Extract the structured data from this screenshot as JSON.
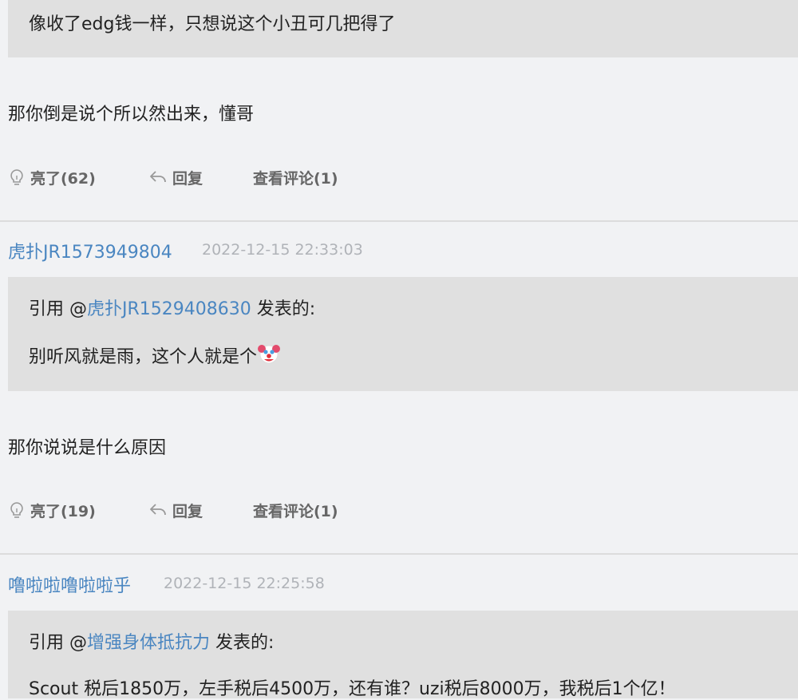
{
  "post0": {
    "quote_text": "像收了edg钱一样，只想说这个小丑可几把得了",
    "reply": "那你倒是说个所以然出来，懂哥",
    "like_label": "亮了(62)",
    "reply_label": "回复",
    "comments_label": "查看评论(1)"
  },
  "post1": {
    "username": "虎扑JR1573949804",
    "time": "2022-12-15 22:33:03",
    "quote_prefix": "引用 @",
    "quote_user": "虎扑JR1529408630",
    "quote_suffix": " 发表的:",
    "quote_text": "别听风就是雨，这个人就是个",
    "quote_emoji": "clown-face-icon",
    "reply": "那你说说是什么原因",
    "like_label": "亮了(19)",
    "reply_label": "回复",
    "comments_label": "查看评论(1)"
  },
  "post2": {
    "username": "噜啦啦噜啦啦乎",
    "time": "2022-12-15 22:25:58",
    "quote_prefix": "引用 @",
    "quote_user": "增强身体抵抗力",
    "quote_suffix": " 发表的:",
    "quote_text": "Scout 税后1850万，左手税后4500万，还有谁？uzi税后8000万，我税后1个亿！"
  },
  "colors": {
    "background": "#f1f2f4",
    "quote_background": "#e0e0e0",
    "link": "#4a86c1",
    "timestamp": "#b0b3b8",
    "action_text": "#666666"
  }
}
